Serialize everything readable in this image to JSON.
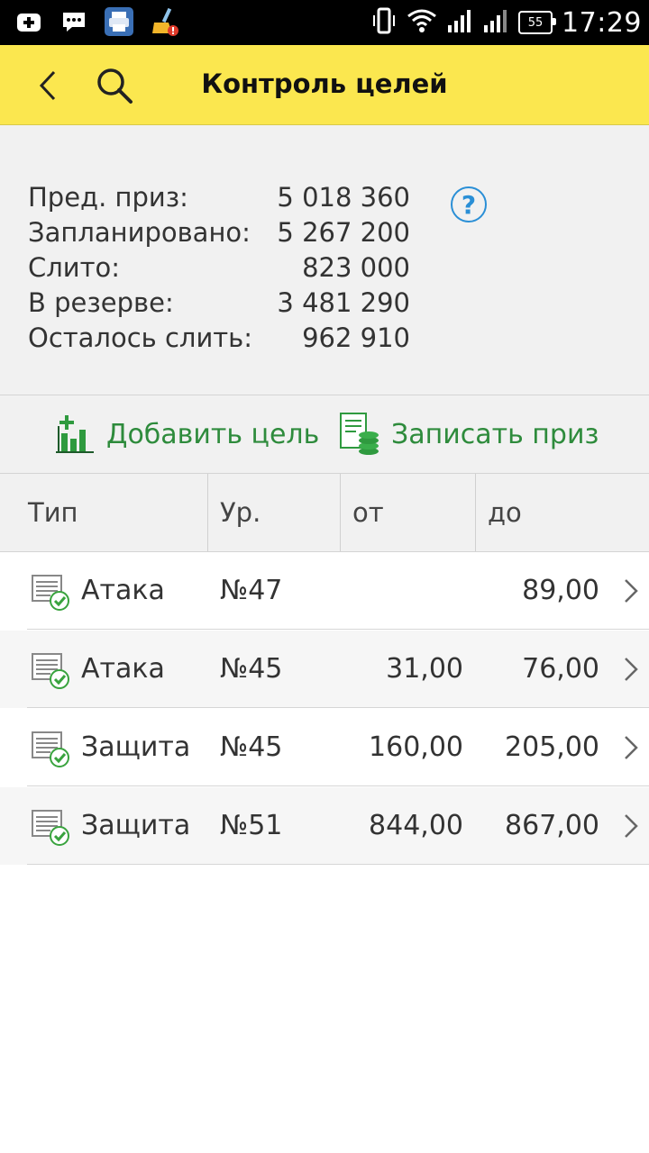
{
  "status_bar": {
    "time": "17:29",
    "battery": "55",
    "icons": [
      "add-icon",
      "message-icon",
      "printer-icon",
      "cleaner-icon",
      "vibrate-icon",
      "wifi-icon",
      "signal-icon",
      "signal-icon-2"
    ]
  },
  "appbar": {
    "title": "Контроль целей",
    "back_icon": "chevron-left-icon",
    "search_icon": "search-icon",
    "background": "#fbe74f"
  },
  "summary": {
    "rows": [
      {
        "label": "Пред. приз:",
        "value": "5 018 360"
      },
      {
        "label": "Запланировано:",
        "value": "5 267 200"
      },
      {
        "label": "Слито:",
        "value": "823 000"
      },
      {
        "label": "В резерве:",
        "value": "3 481 290"
      },
      {
        "label": "Осталось слить:",
        "value": "962 910"
      }
    ],
    "help_label": "?"
  },
  "actions": {
    "add_goal": "Добавить цель",
    "record_prize": "Записать приз",
    "accent": "#2e8b3c"
  },
  "table": {
    "headers": [
      "Тип",
      "Ур.",
      "от",
      "до"
    ],
    "rows": [
      {
        "type": "Атака",
        "level": "№47",
        "from": "",
        "to": "89,00"
      },
      {
        "type": "Атака",
        "level": "№45",
        "from": "31,00",
        "to": "76,00"
      },
      {
        "type": "Защита",
        "level": "№45",
        "from": "160,00",
        "to": "205,00"
      },
      {
        "type": "Защита",
        "level": "№51",
        "from": "844,00",
        "to": "867,00"
      }
    ]
  }
}
